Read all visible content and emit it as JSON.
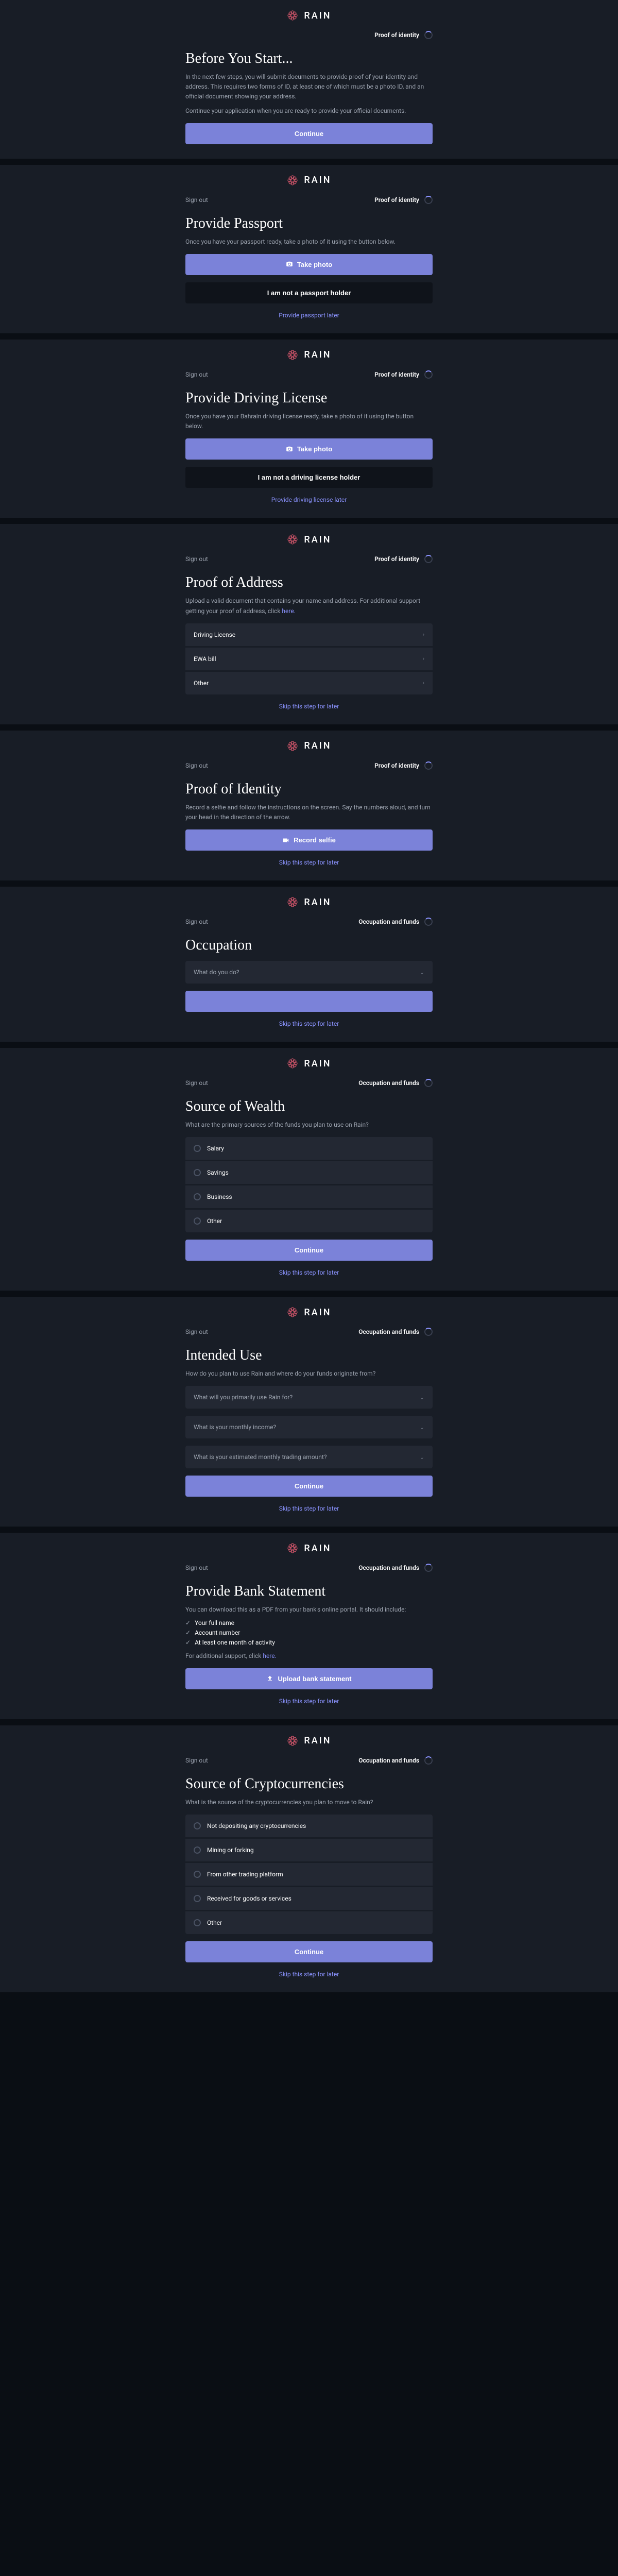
{
  "brand": "RAIN",
  "signout": "Sign out",
  "steps": {
    "identity": "Proof of identity",
    "occupation": "Occupation and funds"
  },
  "s1": {
    "title": "Before You Start...",
    "p1": "In the next few steps, you will submit documents to provide proof of your identity and address. This requires two forms of ID, at least one of which must be a photo ID, and an official document showing your address.",
    "p2": "Continue your application when you are ready to provide your official documents.",
    "btn": "Continue"
  },
  "s2": {
    "title": "Provide Passport",
    "p": "Once you have your passport ready, take a photo of it using the button below.",
    "btn1": "Take photo",
    "btn2": "I am not a passport holder",
    "link": "Provide passport later"
  },
  "s3": {
    "title": "Provide Driving License",
    "p": "Once you have your Bahrain driving license ready, take a photo of it using the button below.",
    "btn1": "Take photo",
    "btn2": "I am not a driving license holder",
    "link": "Provide driving license later"
  },
  "s4": {
    "title": "Proof of Address",
    "p": "Upload a valid document that contains your name and address. For additional support getting your proof of address, click ",
    "here": "here.",
    "items": [
      "Driving License",
      "EWA bill",
      "Other"
    ],
    "link": "Skip this step for later"
  },
  "s5": {
    "title": "Proof of Identity",
    "p": "Record a selfie and follow the instructions on the screen. Say the numbers aloud, and turn your head in the direction of the arrow.",
    "btn": "Record selfie",
    "link": "Skip this step for later"
  },
  "s6": {
    "title": "Occupation",
    "ph": "What do you do?",
    "link": "Skip this step for later"
  },
  "s7": {
    "title": "Source of Wealth",
    "p": "What are the primary sources of the funds you plan to use on Rain?",
    "items": [
      "Salary",
      "Savings",
      "Business",
      "Other"
    ],
    "btn": "Continue",
    "link": "Skip this step for later"
  },
  "s8": {
    "title": "Intended Use",
    "p": "How do you plan to use Rain and where do your funds originate from?",
    "q1": "What will you primarily use Rain for?",
    "q2": "What is your monthly income?",
    "q3": "What is your estimated monthly trading amount?",
    "btn": "Continue",
    "link": "Skip this step for later"
  },
  "s9": {
    "title": "Provide Bank Statement",
    "p": "You can download this as a PDF from your bank's online portal. It should include:",
    "c1": "Your full name",
    "c2": "Account number",
    "c3": "At least one month of activity",
    "p2": "For additional support, click ",
    "here": "here.",
    "btn": "Upload bank statement",
    "link": "Skip this step for later"
  },
  "s10": {
    "title": "Source of Cryptocurrencies",
    "p": "What is the source of the cryptocurrencies you plan to move to Rain?",
    "items": [
      "Not depositing any cryptocurrencies",
      "Mining or forking",
      "From other trading platform",
      "Received for goods or services",
      "Other"
    ],
    "btn": "Continue",
    "link": "Skip this step for later"
  }
}
